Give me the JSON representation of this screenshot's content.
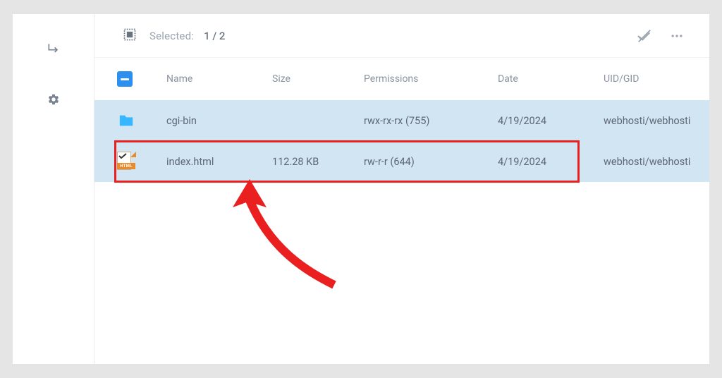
{
  "toolbar": {
    "selected_label": "Selected:",
    "selected_count": "1 / 2"
  },
  "columns": {
    "name": "Name",
    "size": "Size",
    "permissions": "Permissions",
    "date": "Date",
    "uidgid": "UID/GID"
  },
  "rows": [
    {
      "icon": "folder",
      "name": "cgi-bin",
      "size": "",
      "permissions": "rwx-rx-rx (755)",
      "date": "4/19/2024",
      "uidgid": "webhosti/webhosti",
      "selected": true
    },
    {
      "icon": "html",
      "name": "index.html",
      "size": "112.28 KB",
      "permissions": "rw-r-r (644)",
      "date": "4/19/2024",
      "uidgid": "webhosti/webhosti",
      "selected": true
    }
  ],
  "html_badge": "HTML"
}
